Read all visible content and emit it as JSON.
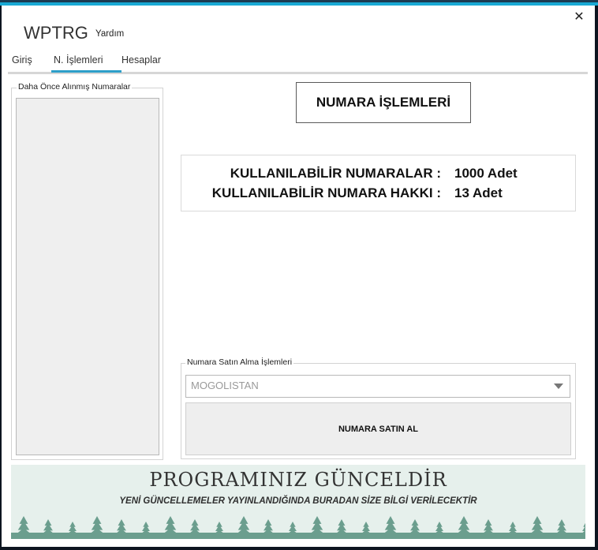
{
  "window": {
    "title": "WPTRG",
    "help_menu": "Yardım",
    "close_glyph": "✕"
  },
  "tabs": [
    {
      "label": "Giriş",
      "active": false
    },
    {
      "label": "N. İşlemleri",
      "active": true
    },
    {
      "label": "Hesaplar",
      "active": false
    }
  ],
  "left_panel": {
    "legend": "Daha Önce Alınmış Numaralar",
    "items": []
  },
  "main": {
    "heading_button": "NUMARA İŞLEMLERİ",
    "info": {
      "row1_label": "KULLANILABİLİR NUMARALAR :",
      "row1_value": "1000 Adet",
      "row2_label": "KULLANILABİLİR NUMARA HAKKI :",
      "row2_value": "13 Adet"
    },
    "purchase": {
      "legend": "Numara Satın Alma İşlemleri",
      "country_selected": "MOGOLISTAN",
      "buy_button": "NUMARA SATIN AL"
    }
  },
  "banner": {
    "title": "PROGRAMINIZ GÜNCELDİR",
    "subtitle": "YENİ GÜNCELLEMELER YAYINLANDIĞINDA BURADAN SİZE BİLGİ VERİLECEKTİR",
    "tree_color": "#6b9e8e"
  },
  "colors": {
    "accent": "#19a9d4",
    "tab_underline": "#2d9fc9"
  }
}
